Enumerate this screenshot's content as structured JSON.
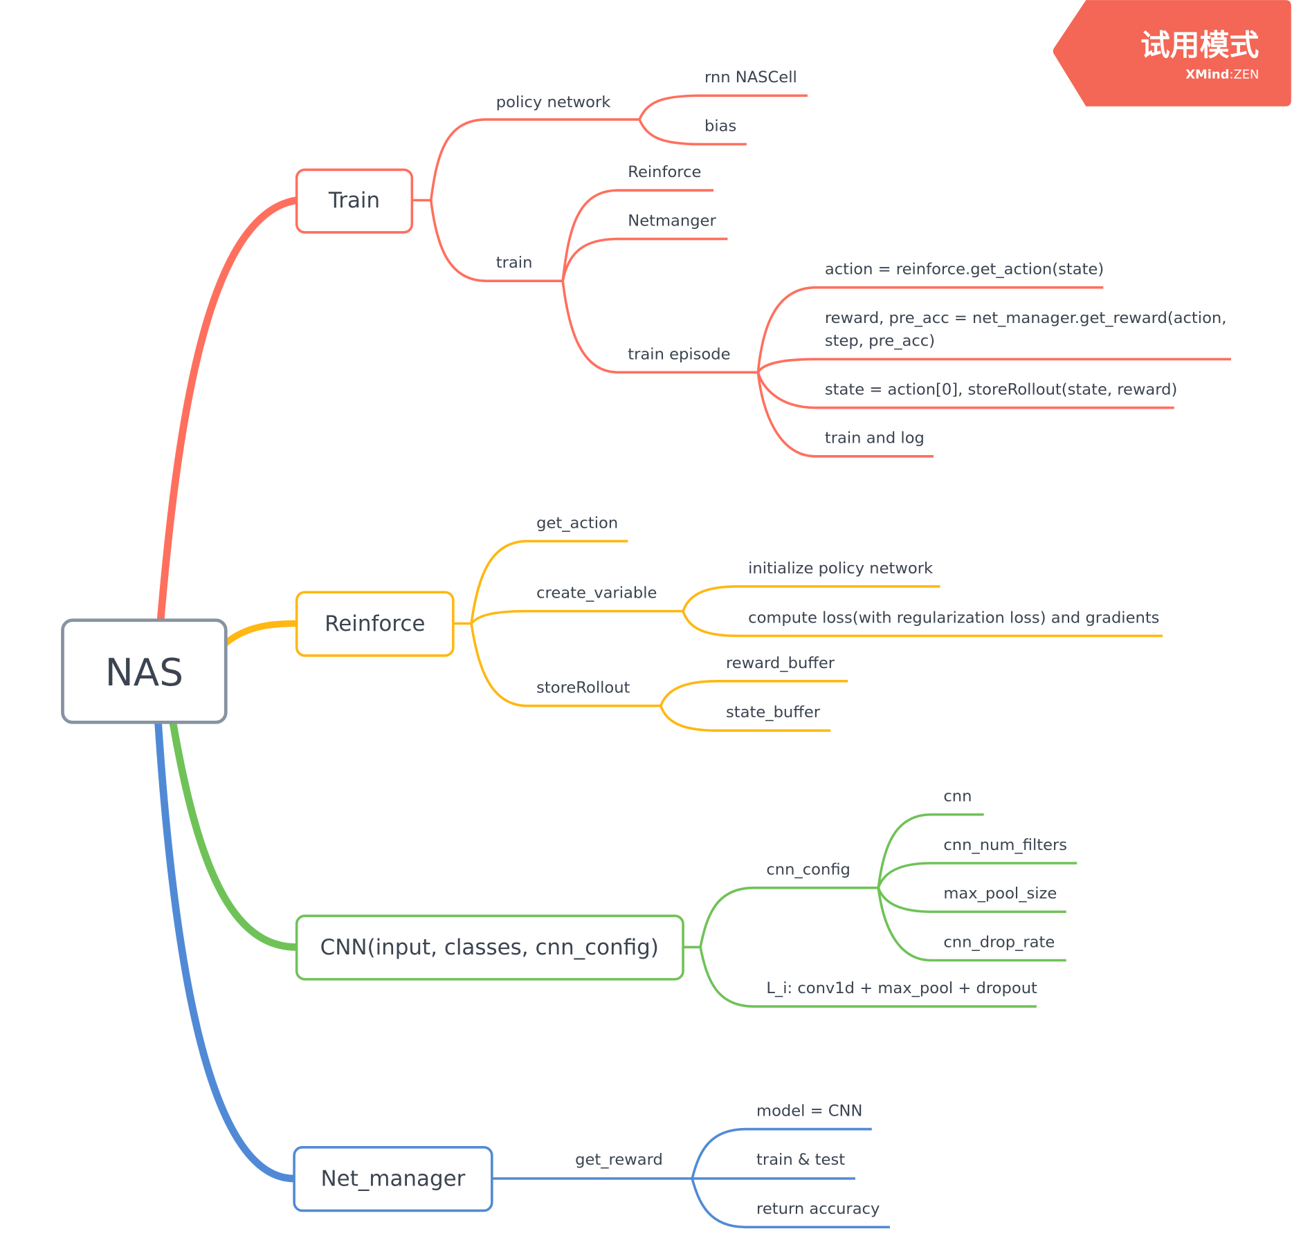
{
  "root": {
    "label": "NAS",
    "color": "#8793a3"
  },
  "colors": {
    "train": "#ff6f5e",
    "reinforce": "#ffb711",
    "cnn": "#6fc257",
    "net": "#508ad6",
    "text": "#3b4450"
  },
  "watermark": {
    "title": "试用模式",
    "brand": "XMind",
    "separator": ":",
    "edition": "ZEN",
    "color": "#f46655"
  },
  "branches": {
    "train": {
      "label": "Train",
      "children": {
        "policy_network": {
          "label": "policy network",
          "children": [
            "rnn NASCell",
            "bias"
          ]
        },
        "train": {
          "label": "train",
          "children": {
            "reinforce": "Reinforce",
            "netmanger": "Netmanger",
            "train_episode": {
              "label": "train episode",
              "children": [
                "action = reinforce.get_action(state)",
                "reward, pre_acc = net_manager.get_reward(action,",
                "step, pre_acc)",
                "state = action[0], storeRollout(state, reward)",
                "train and log"
              ]
            }
          }
        }
      }
    },
    "reinforce": {
      "label": "Reinforce",
      "children": {
        "get_action": "get_action",
        "create_variable": {
          "label": "create_variable",
          "children": [
            "initialize policy network",
            "compute loss(with regularization loss) and gradients"
          ]
        },
        "storeRollout": {
          "label": "storeRollout",
          "children": [
            "reward_buffer",
            "state_buffer"
          ]
        }
      }
    },
    "cnn": {
      "label": "CNN(input, classes, cnn_config)",
      "children": {
        "cnn_config": {
          "label": "cnn_config",
          "children": [
            "cnn",
            "cnn_num_filters",
            "max_pool_size",
            "cnn_drop_rate"
          ]
        },
        "layer": "L_i: conv1d + max_pool + dropout"
      }
    },
    "net_manager": {
      "label": "Net_manager",
      "children": {
        "get_reward": {
          "label": "get_reward",
          "children": [
            "model = CNN",
            "train & test",
            "return accuracy"
          ]
        }
      }
    }
  }
}
